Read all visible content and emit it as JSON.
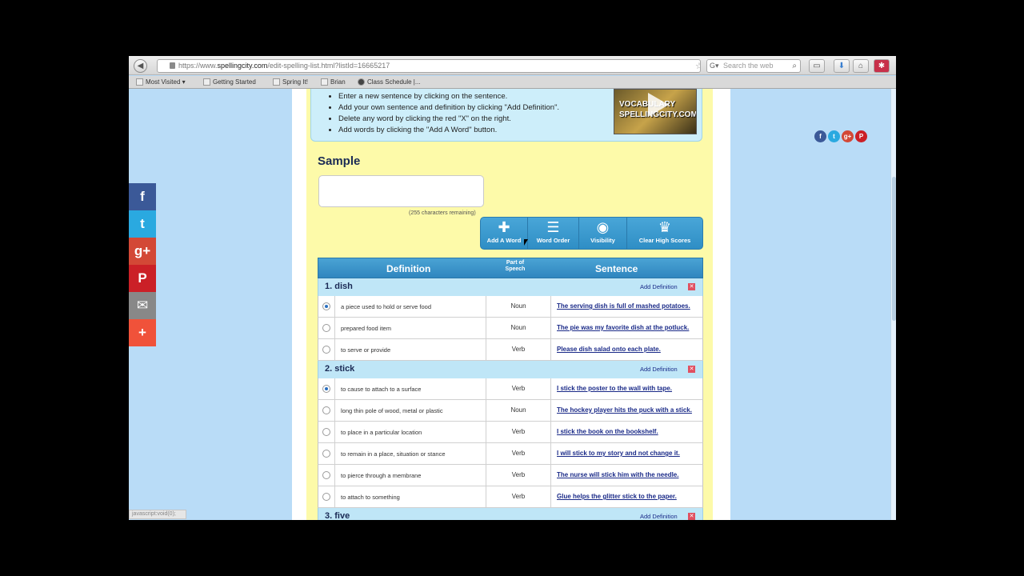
{
  "browser": {
    "url_prefix": "https://www.",
    "url_host": "spellingcity.com",
    "url_path": "/edit-spelling-list.html?listId=16665217",
    "search_placeholder": "Search the web",
    "bookmarks": [
      "Most Visited",
      "Getting Started",
      "Spring It!",
      "Brian",
      "Class Schedule |..."
    ],
    "status_text": "javascript:void(0);"
  },
  "instructions": [
    "Enter a new sentence by clicking on the sentence.",
    "Add your own sentence and definition by clicking \"Add Definition\".",
    "Delete any word by clicking the red \"X\" on the right.",
    "Add words by clicking the \"Add A Word\" button."
  ],
  "video_thumb_text": "VOCABULARY SPELLINGCITY.COM",
  "sample": {
    "title": "Sample",
    "chars_remaining": "(255 characters remaining)"
  },
  "toolbar": [
    {
      "label": "Add A Word",
      "icon": "plus-icon"
    },
    {
      "label": "Word Order",
      "icon": "sort-icon"
    },
    {
      "label": "Visibility",
      "icon": "eye-icon"
    },
    {
      "label": "Clear High Scores",
      "icon": "trophy-reset-icon"
    }
  ],
  "table": {
    "col_definition": "Definition",
    "col_pos": "Part of Speech",
    "col_sentence": "Sentence",
    "add_definition_label": "Add Definition",
    "words": [
      {
        "title": "1. dish",
        "rows": [
          {
            "selected": true,
            "definition": "a piece used to hold or serve food",
            "pos": "Noun",
            "sentence": "The serving dish is full of mashed potatoes."
          },
          {
            "selected": false,
            "definition": "prepared food item",
            "pos": "Noun",
            "sentence": "The pie was my favorite dish at the potluck."
          },
          {
            "selected": false,
            "definition": "to serve or provide",
            "pos": "Verb",
            "sentence": "Please dish salad onto each plate."
          }
        ]
      },
      {
        "title": "2. stick",
        "rows": [
          {
            "selected": true,
            "definition": "to cause to attach to a surface",
            "pos": "Verb",
            "sentence": "I stick the poster to the wall with tape."
          },
          {
            "selected": false,
            "definition": "long thin pole of wood, metal or plastic",
            "pos": "Noun",
            "sentence": "The hockey player hits the puck with a stick."
          },
          {
            "selected": false,
            "definition": "to place in a particular location",
            "pos": "Verb",
            "sentence": "I stick the book on the bookshelf."
          },
          {
            "selected": false,
            "definition": "to remain in a place, situation or stance",
            "pos": "Verb",
            "sentence": "I will stick to my story and not change it."
          },
          {
            "selected": false,
            "definition": "to pierce through a membrane",
            "pos": "Verb",
            "sentence": "The nurse will stick him with the needle."
          },
          {
            "selected": false,
            "definition": "to attach to something",
            "pos": "Verb",
            "sentence": "Glue helps the glitter stick to the paper."
          }
        ]
      },
      {
        "title": "3. five",
        "rows": []
      }
    ]
  },
  "share_sidebar": [
    {
      "icon": "facebook-icon",
      "glyph": "f",
      "color": "#3b5998"
    },
    {
      "icon": "twitter-icon",
      "glyph": "t",
      "color": "#2aa9e0"
    },
    {
      "icon": "google-plus-icon",
      "glyph": "g+",
      "color": "#d34836"
    },
    {
      "icon": "pinterest-icon",
      "glyph": "P",
      "color": "#cb2027"
    },
    {
      "icon": "email-icon",
      "glyph": "✉",
      "color": "#888888"
    },
    {
      "icon": "more-icon",
      "glyph": "+",
      "color": "#f0523a"
    }
  ],
  "social_top": [
    {
      "icon": "facebook-icon",
      "glyph": "f",
      "color": "#3b5998"
    },
    {
      "icon": "twitter-icon",
      "glyph": "t",
      "color": "#2aa9e0"
    },
    {
      "icon": "google-plus-icon",
      "glyph": "g+",
      "color": "#d34836"
    },
    {
      "icon": "pinterest-icon",
      "glyph": "P",
      "color": "#cb2027"
    }
  ]
}
